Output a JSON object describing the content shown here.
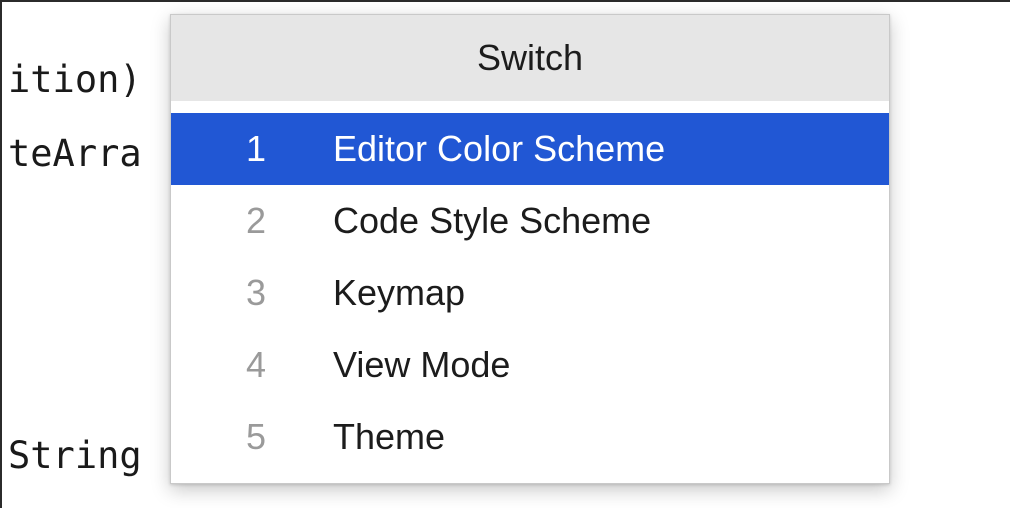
{
  "editor": {
    "code_lines": [
      "ition)",
      "teArra",
      "String"
    ]
  },
  "popup": {
    "title": "Switch",
    "items": [
      {
        "number": "1",
        "label": "Editor Color Scheme",
        "selected": true
      },
      {
        "number": "2",
        "label": "Code Style Scheme",
        "selected": false
      },
      {
        "number": "3",
        "label": "Keymap",
        "selected": false
      },
      {
        "number": "4",
        "label": "View Mode",
        "selected": false
      },
      {
        "number": "5",
        "label": "Theme",
        "selected": false
      }
    ]
  },
  "colors": {
    "selection": "#2157d4",
    "header_background": "#e6e6e6"
  }
}
